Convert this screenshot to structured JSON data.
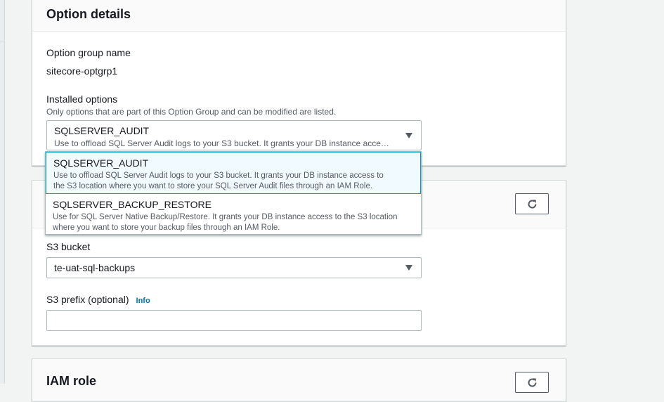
{
  "option_details": {
    "title": "Option details",
    "group_name_label": "Option group name",
    "group_name_value": "sitecore-optgrp1",
    "installed_label": "Installed options",
    "installed_desc": "Only options that are part of this Option Group and can be modified are listed.",
    "selected_option": {
      "title": "SQLSERVER_AUDIT",
      "desc": "Use to offload SQL Server Audit logs to your S3 bucket. It grants your DB instance acce…"
    }
  },
  "dropdown": {
    "options": [
      {
        "title": "SQLSERVER_AUDIT",
        "desc_line1": "Use to offload SQL Server Audit logs to your S3 bucket. It grants your DB instance access to",
        "desc_line2": "the S3 location where you want to store your SQL Server Audit files through an IAM Role."
      },
      {
        "title": "SQLSERVER_BACKUP_RESTORE",
        "desc_line1": "Use for SQL Server Native Backup/Restore. It grants your DB instance access to the S3 location",
        "desc_line2": "where you want to store your backup files through an IAM Role."
      }
    ]
  },
  "s3_panel": {
    "bucket_label": "S3 bucket",
    "bucket_value": "te-uat-sql-backups",
    "prefix_label": "S3 prefix (optional)",
    "prefix_info": "Info",
    "prefix_value": ""
  },
  "iam_panel": {
    "title": "IAM role"
  },
  "icons": {
    "refresh": "refresh-icon",
    "caret": "caret-down-icon"
  },
  "colors": {
    "background": "#f2f3f3",
    "selected_option_bg": "#f1faff",
    "selected_option_border": "#00a1c9",
    "link": "#0073bb"
  }
}
